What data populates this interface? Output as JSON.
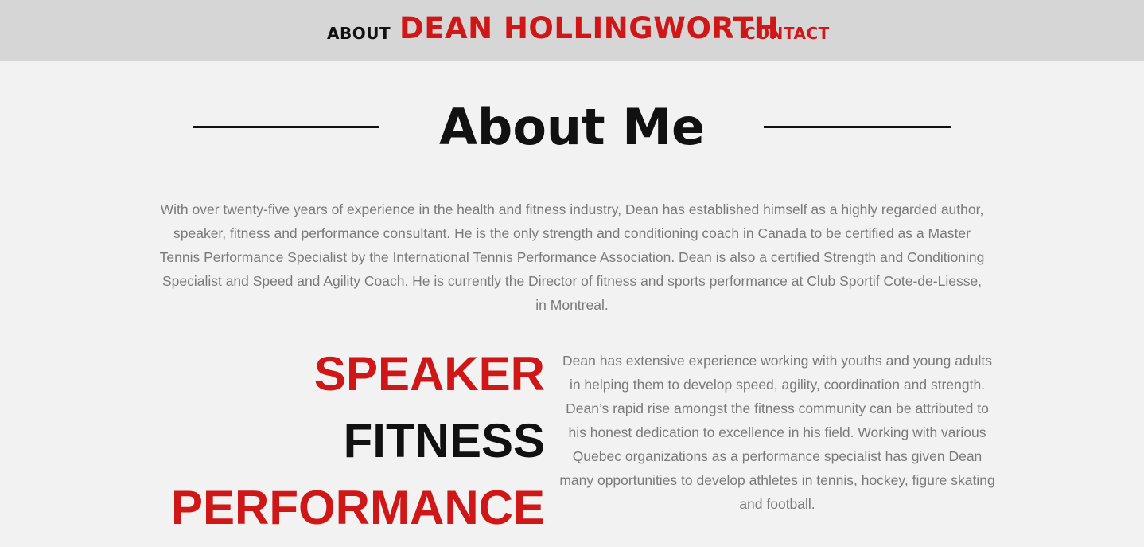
{
  "nav": {
    "about_label": "ABOUT",
    "brand": "DEAN HOLLINGWORTH",
    "contact_label": "CONTACT"
  },
  "about": {
    "heading": "About Me",
    "intro": "With over twenty-five years of experience in the health and fitness industry, Dean has established himself as a highly regarded author, speaker, fitness and performance consultant. He is the only strength and conditioning coach in Canada to be certified as a Master Tennis Performance Specialist by the International Tennis Performance Association. Dean is also a certified Strength and Conditioning Specialist and Speed and Agility Coach. He is currently the Director of fitness and sports performance at Club Sportif Cote-de-Liesse, in Montreal."
  },
  "roles": {
    "items": [
      "SPEAKER",
      "FITNESS",
      "PERFORMANCE"
    ]
  },
  "bio": {
    "text": "Dean has extensive experience working with youths and young adults in helping them to develop speed, agility, coordination and strength. Dean’s rapid rise amongst the fitness community can be attributed to his honest dedication to excellence in his field. Working with various Quebec organizations as a performance specialist has given Dean many opportunities to develop athletes in tennis, hockey, figure skating and football."
  },
  "colors": {
    "accent": "#cf1717",
    "text_dark": "#111111",
    "text_muted": "#7a7a7a",
    "nav_bg": "#d6d6d6",
    "page_bg": "#f2f2f2"
  }
}
